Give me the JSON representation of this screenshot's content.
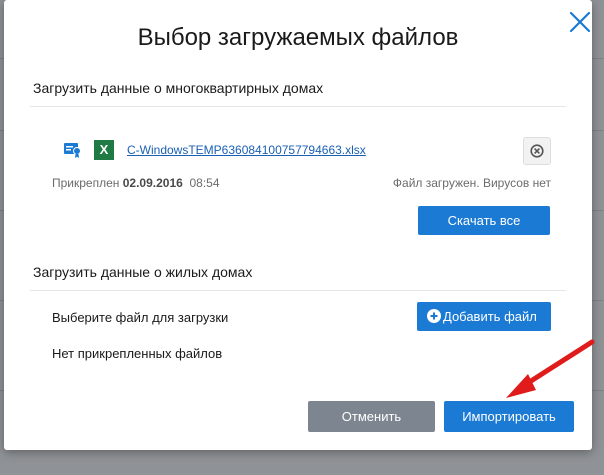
{
  "dialog": {
    "title": "Выбор загружаемых файлов",
    "close_icon": "close-icon"
  },
  "section1": {
    "title": "Загрузить данные о многоквартирных домах",
    "file": {
      "name": "C-WindowsTEMP636084100757794663.xlsx",
      "attached_label": "Прикреплен",
      "attached_date": "02.09.2016",
      "attached_time": "08:54",
      "status": "Файл загружен. Вирусов нет",
      "sign_icon": "signature-icon",
      "type_icon": "excel-icon",
      "type_letter": "X",
      "remove_icon": "remove-icon"
    },
    "download_all_label": "Скачать все"
  },
  "section2": {
    "title": "Загрузить данные о жилых домах",
    "choose_label": "Выберите файл для загрузки",
    "add_file_label": "Добавить файл",
    "add_icon": "plus-circle-icon",
    "no_files_label": "Нет прикрепленных файлов"
  },
  "footer": {
    "cancel_label": "Отменить",
    "import_label": "Импортировать"
  },
  "colors": {
    "primary": "#1a7ad4",
    "secondary": "#7d8590",
    "link": "#1a5fb4",
    "excel": "#1f7a44",
    "annotation_arrow": "#e01b1b"
  }
}
